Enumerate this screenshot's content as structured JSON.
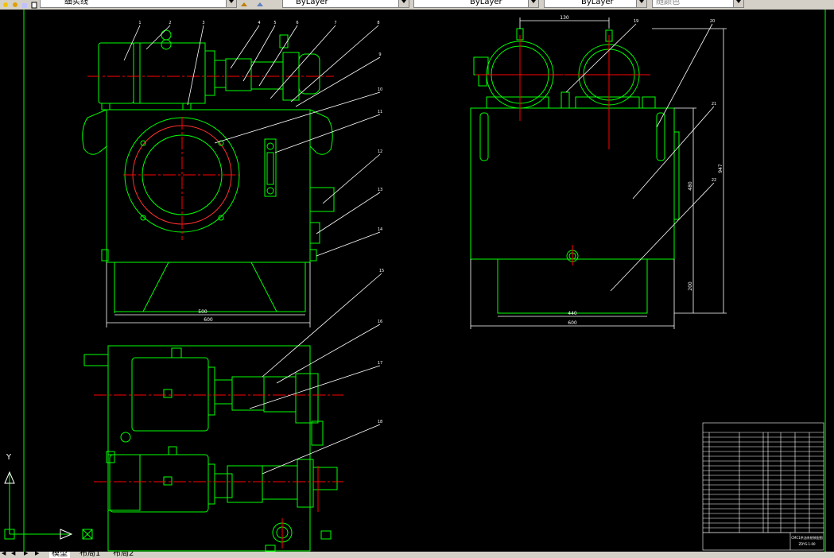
{
  "toolbar": {
    "layer_name": "细实线",
    "color_control": "ByLayer",
    "linetype_control": "ByLayer",
    "lineweight_control": "ByLayer",
    "plotstyle_control": "随颜色"
  },
  "tabs": {
    "model": "模型",
    "layout1": "布局1",
    "layout2": "布局2"
  },
  "ucs": {
    "y_label": "Y",
    "x_label": "X"
  },
  "dims": {
    "front_inner": "500",
    "front_outer": "600",
    "side_inner": "440",
    "side_outer": "600",
    "side_top": "130",
    "side_height_upper": "480",
    "side_height_lower": "200",
    "side_height_total": "947"
  },
  "balloons": [
    "1",
    "2",
    "3",
    "4",
    "5",
    "6",
    "7",
    "8",
    "9",
    "10",
    "11",
    "12",
    "13",
    "14",
    "15",
    "16",
    "17",
    "18",
    "19",
    "20",
    "21",
    "22"
  ],
  "title_block": {
    "title": "CMC1供油系统装配图",
    "drawing_no": "ZDYS-1-00"
  },
  "colors": {
    "background": "#000000",
    "outline": "#00ff00",
    "centerline": "#ff0000",
    "leader": "#ffffff",
    "dimension": "#ffffff",
    "ui_face": "#d4d0c8"
  }
}
